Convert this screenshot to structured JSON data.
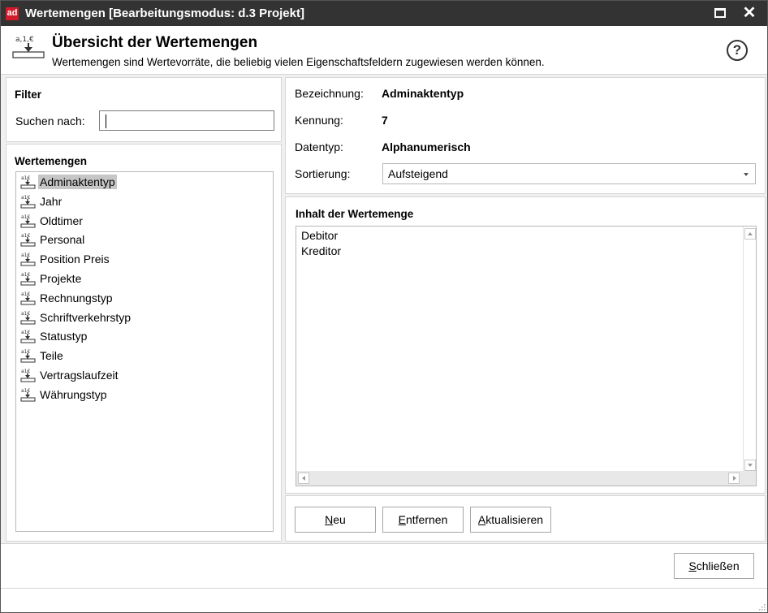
{
  "window": {
    "logo_text": "ad",
    "title": "Wertemengen  [Bearbeitungsmodus: d.3 Projekt]",
    "close_glyph": "✕",
    "logo_color": "#d11a2a"
  },
  "header": {
    "icon_text": "a,1,€",
    "title": "Übersicht der Wertemengen",
    "description": "Wertemengen sind Wertevorräte, die beliebig vielen Eigenschaftsfeldern zugewiesen werden können.",
    "help_glyph": "?"
  },
  "filter": {
    "title": "Filter",
    "search_label": "Suchen nach:",
    "search_value": ""
  },
  "sets": {
    "title": "Wertemengen",
    "items": [
      {
        "label": "Adminaktentyp",
        "selected": true
      },
      {
        "label": "Jahr"
      },
      {
        "label": "Oldtimer"
      },
      {
        "label": "Personal"
      },
      {
        "label": "Position Preis"
      },
      {
        "label": "Projekte"
      },
      {
        "label": "Rechnungstyp"
      },
      {
        "label": "Schriftverkehrstyp"
      },
      {
        "label": "Statustyp"
      },
      {
        "label": "Teile"
      },
      {
        "label": "Vertragslaufzeit"
      },
      {
        "label": "Währungstyp"
      }
    ]
  },
  "properties": {
    "name_label": "Bezeichnung:",
    "name_value": "Adminaktentyp",
    "id_label": "Kennung:",
    "id_value": "7",
    "type_label": "Datentyp:",
    "type_value": "Alphanumerisch",
    "sort_label": "Sortierung:",
    "sort_value": "Aufsteigend"
  },
  "content": {
    "title": "Inhalt der Wertemenge",
    "items": [
      "Debitor",
      "Kreditor"
    ]
  },
  "actions": {
    "new_mnemonic": "N",
    "new_rest": "eu",
    "remove_mnemonic": "E",
    "remove_rest": "ntfernen",
    "refresh_mnemonic": "A",
    "refresh_rest": "ktualisieren"
  },
  "footer": {
    "close_mnemonic": "S",
    "close_rest": "chließen"
  }
}
